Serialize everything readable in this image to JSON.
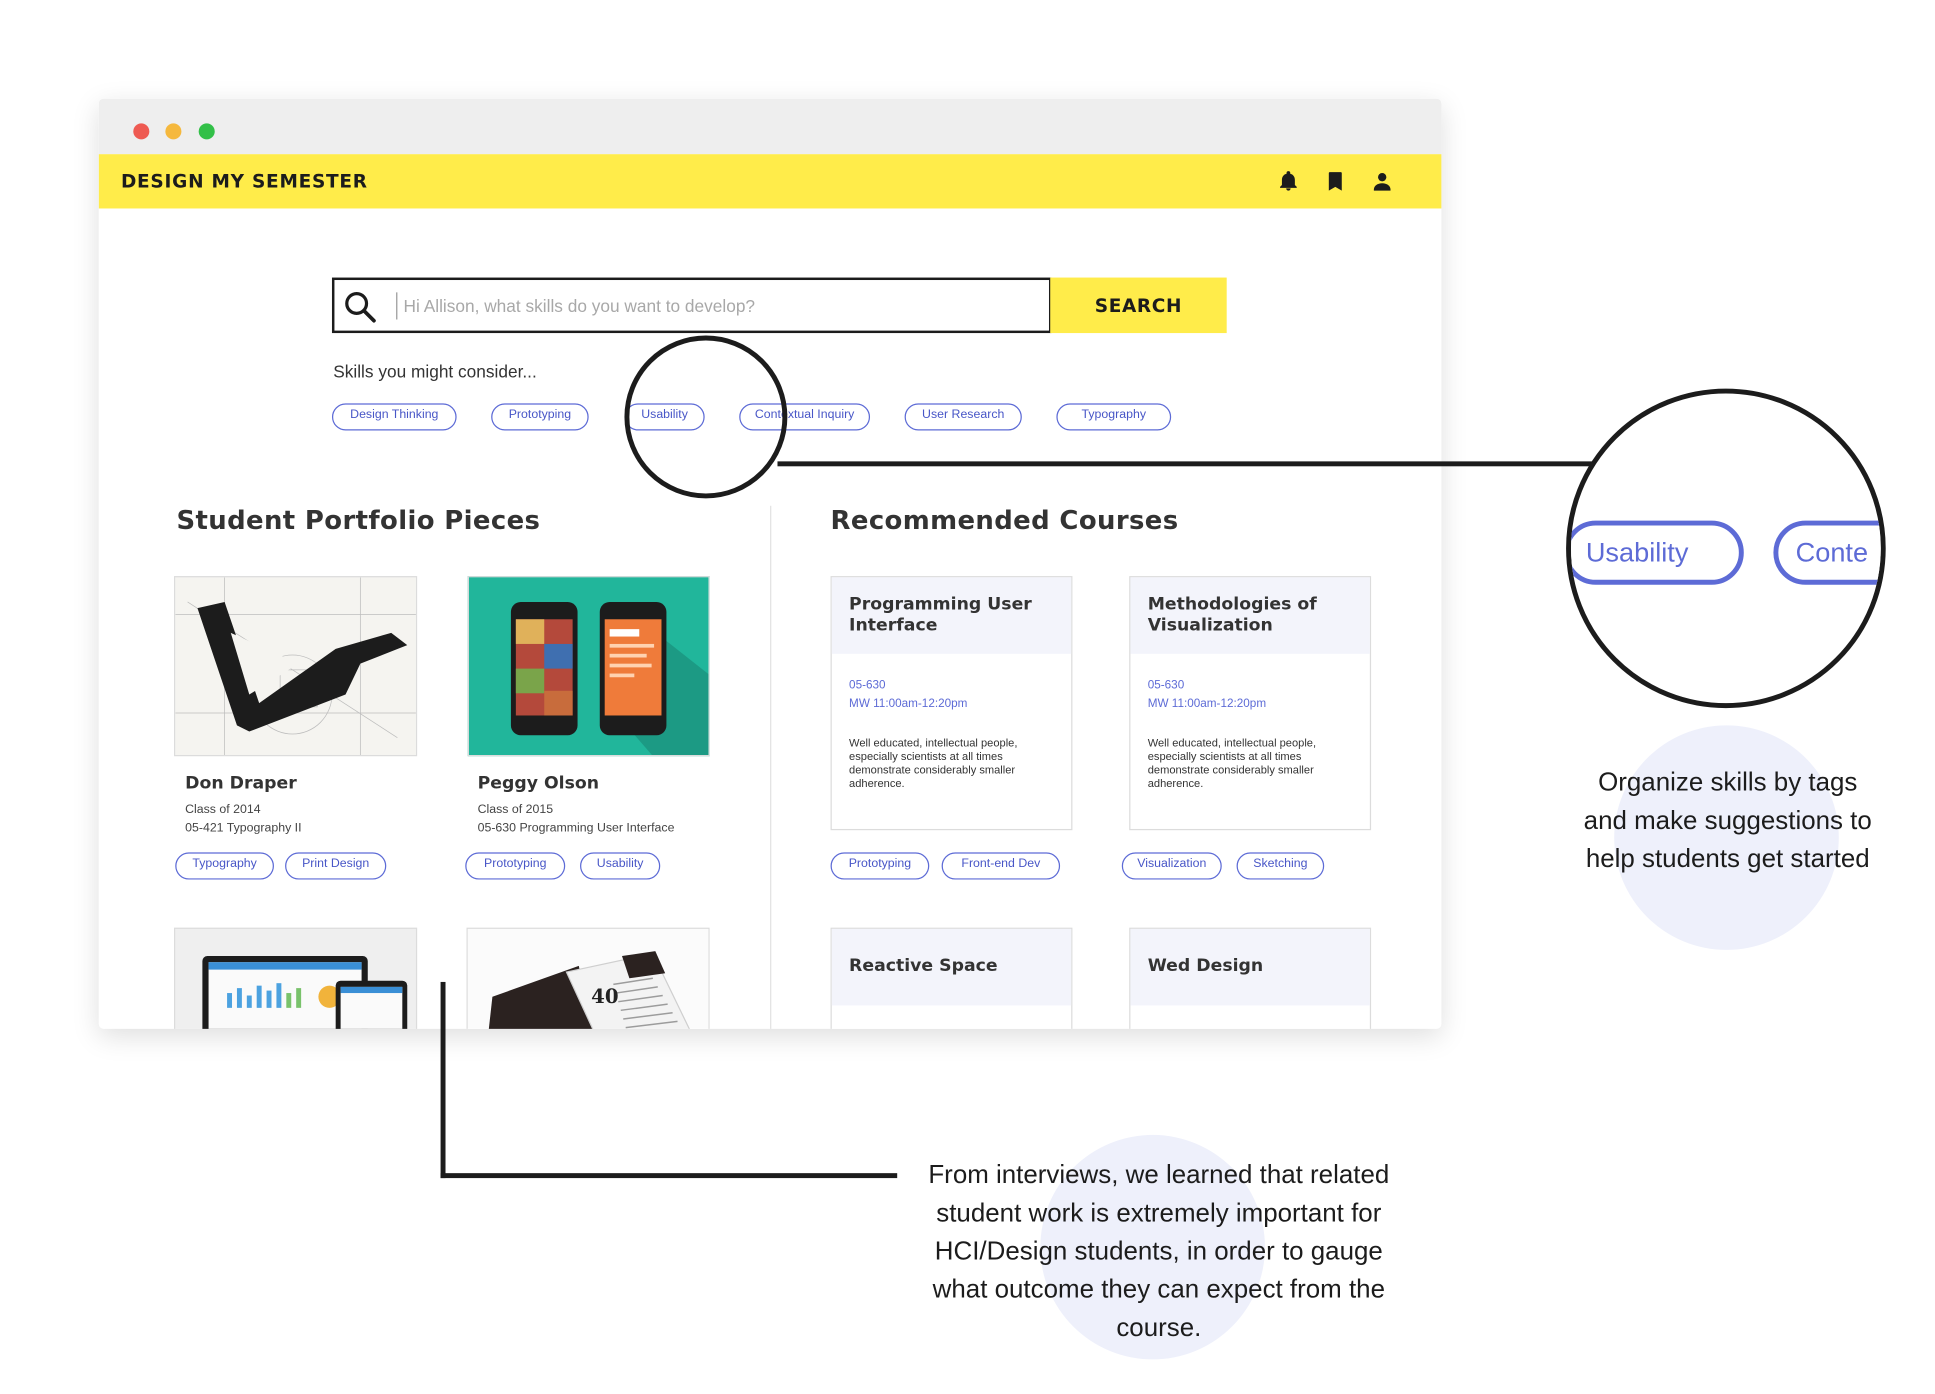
{
  "app": {
    "title": "DESIGN MY SEMESTER",
    "nav_icons": [
      "bell-icon",
      "bookmark-icon",
      "user-icon"
    ]
  },
  "search": {
    "placeholder": "Hi Allison, what skills do you want to develop?",
    "button_label": "SEARCH"
  },
  "suggestions": {
    "label": "Skills you might consider...",
    "tags": [
      "Design Thinking",
      "Prototyping",
      "Usability",
      "Contextual Inquiry",
      "User Research",
      "Typography"
    ]
  },
  "portfolio": {
    "title": "Student Portfolio Pieces",
    "items": [
      {
        "name": "Don Draper",
        "class": "Class of 2014",
        "course": "05-421 Typography II",
        "tags": [
          "Typography",
          "Print Design"
        ]
      },
      {
        "name": "Peggy Olson",
        "class": "Class of 2015",
        "course": "05-630 Programming User Interface",
        "tags": [
          "Prototyping",
          "Usability"
        ]
      }
    ],
    "magazine_page_number": "40"
  },
  "courses": {
    "title": "Recommended Courses",
    "items": [
      {
        "title": "Programming User Interface",
        "code": "05-630",
        "time": "MW 11:00am-12:20pm",
        "description": "Well educated, intellectual people, especially scientists at all times demonstrate considerably smaller adherence.",
        "tags": [
          "Prototyping",
          "Front-end Dev"
        ]
      },
      {
        "title": "Methodologies of Visualization",
        "code": "05-630",
        "time": "MW 11:00am-12:20pm",
        "description": "Well educated, intellectual people, especially scientists at all times demonstrate considerably smaller adherence.",
        "tags": [
          "Visualization",
          "Sketching"
        ]
      },
      {
        "title": "Reactive Space"
      },
      {
        "title": "Wed Design"
      }
    ]
  },
  "annotations": {
    "zoom_tags": [
      "Usability",
      "Conte"
    ],
    "skills_note": "Organize skills by tags and make suggestions to help students get started",
    "portfolio_note": "From interviews, we learned that related student work is extremely important for HCI/Design students, in order to gauge what outcome they can expect from the course."
  },
  "colors": {
    "brand_yellow": "#ffec4a",
    "tag_blue": "#5d6bd6",
    "card_head": "#f3f4fb",
    "bubble": "#eef0fb"
  }
}
